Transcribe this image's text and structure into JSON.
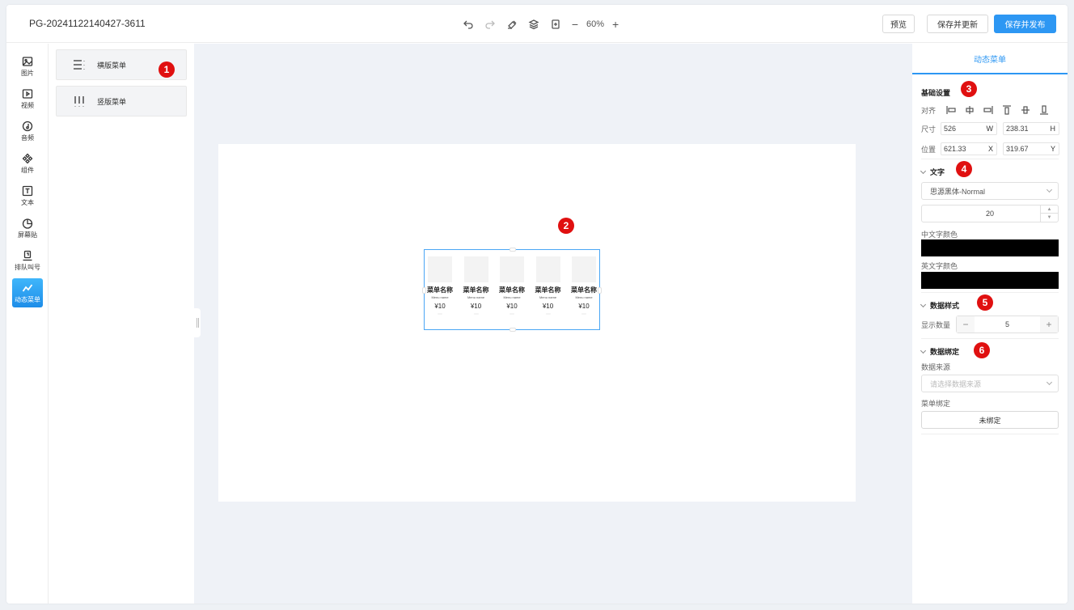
{
  "header": {
    "doc_title": "PG-20241122140427-3611",
    "zoom": "60%",
    "tools": [
      "undo-icon",
      "redo-icon",
      "clear-icon",
      "layers-icon",
      "fit-icon"
    ],
    "buttons": {
      "preview": "预览",
      "save_update": "保存并更新",
      "save_publish": "保存并发布"
    },
    "accent_color": "#2d97f3"
  },
  "sidebar": {
    "items": [
      {
        "label": "图片",
        "icon": "image-icon"
      },
      {
        "label": "视频",
        "icon": "video-icon"
      },
      {
        "label": "音频",
        "icon": "audio-icon"
      },
      {
        "label": "组件",
        "icon": "component-icon"
      },
      {
        "label": "文本",
        "icon": "text-icon"
      },
      {
        "label": "屏幕贴",
        "icon": "pie-icon"
      },
      {
        "label": "排队叫号",
        "icon": "queue-icon"
      },
      {
        "label": "动态菜单",
        "icon": "dynamic-menu-icon",
        "active": true
      }
    ]
  },
  "components": [
    {
      "label": "横版菜单",
      "icon": "horizontal-menu-icon"
    },
    {
      "label": "竖版菜单",
      "icon": "vertical-menu-icon"
    }
  ],
  "badges": [
    "1",
    "2",
    "3",
    "4",
    "5",
    "6"
  ],
  "canvas": {
    "menu_items": [
      {
        "name": "菜单名称",
        "name_en": "Menu name",
        "price": "¥10"
      },
      {
        "name": "菜单名称",
        "name_en": "Menu name",
        "price": "¥10"
      },
      {
        "name": "菜单名称",
        "name_en": "Menu name",
        "price": "¥10"
      },
      {
        "name": "菜单名称",
        "name_en": "Menu name",
        "price": "¥10"
      },
      {
        "name": "菜单名称",
        "name_en": "Menu name",
        "price": "¥10"
      }
    ]
  },
  "panel": {
    "tab": "动态菜单",
    "basic": {
      "title": "基础设置",
      "align_label": "对齐",
      "size_label": "尺寸",
      "width": "526",
      "w_suffix": "W",
      "height": "238.31",
      "h_suffix": "H",
      "position_label": "位置",
      "x": "621.33",
      "x_suffix": "X",
      "y": "319.67",
      "y_suffix": "Y"
    },
    "text": {
      "title": "文字",
      "font": "思源黑体-Normal",
      "font_size": "20",
      "cn_color_label": "中文字颜色",
      "en_color_label": "英文字颜色",
      "cn_color": "#000000",
      "en_color": "#000000"
    },
    "data_style": {
      "title": "数据样式",
      "count_label": "显示数量",
      "count": "5"
    },
    "data_binding": {
      "title": "数据绑定",
      "source_label": "数据来源",
      "source_placeholder": "请选择数据来源",
      "menu_bind_label": "菜单绑定",
      "menu_bind_value": "未绑定"
    }
  }
}
